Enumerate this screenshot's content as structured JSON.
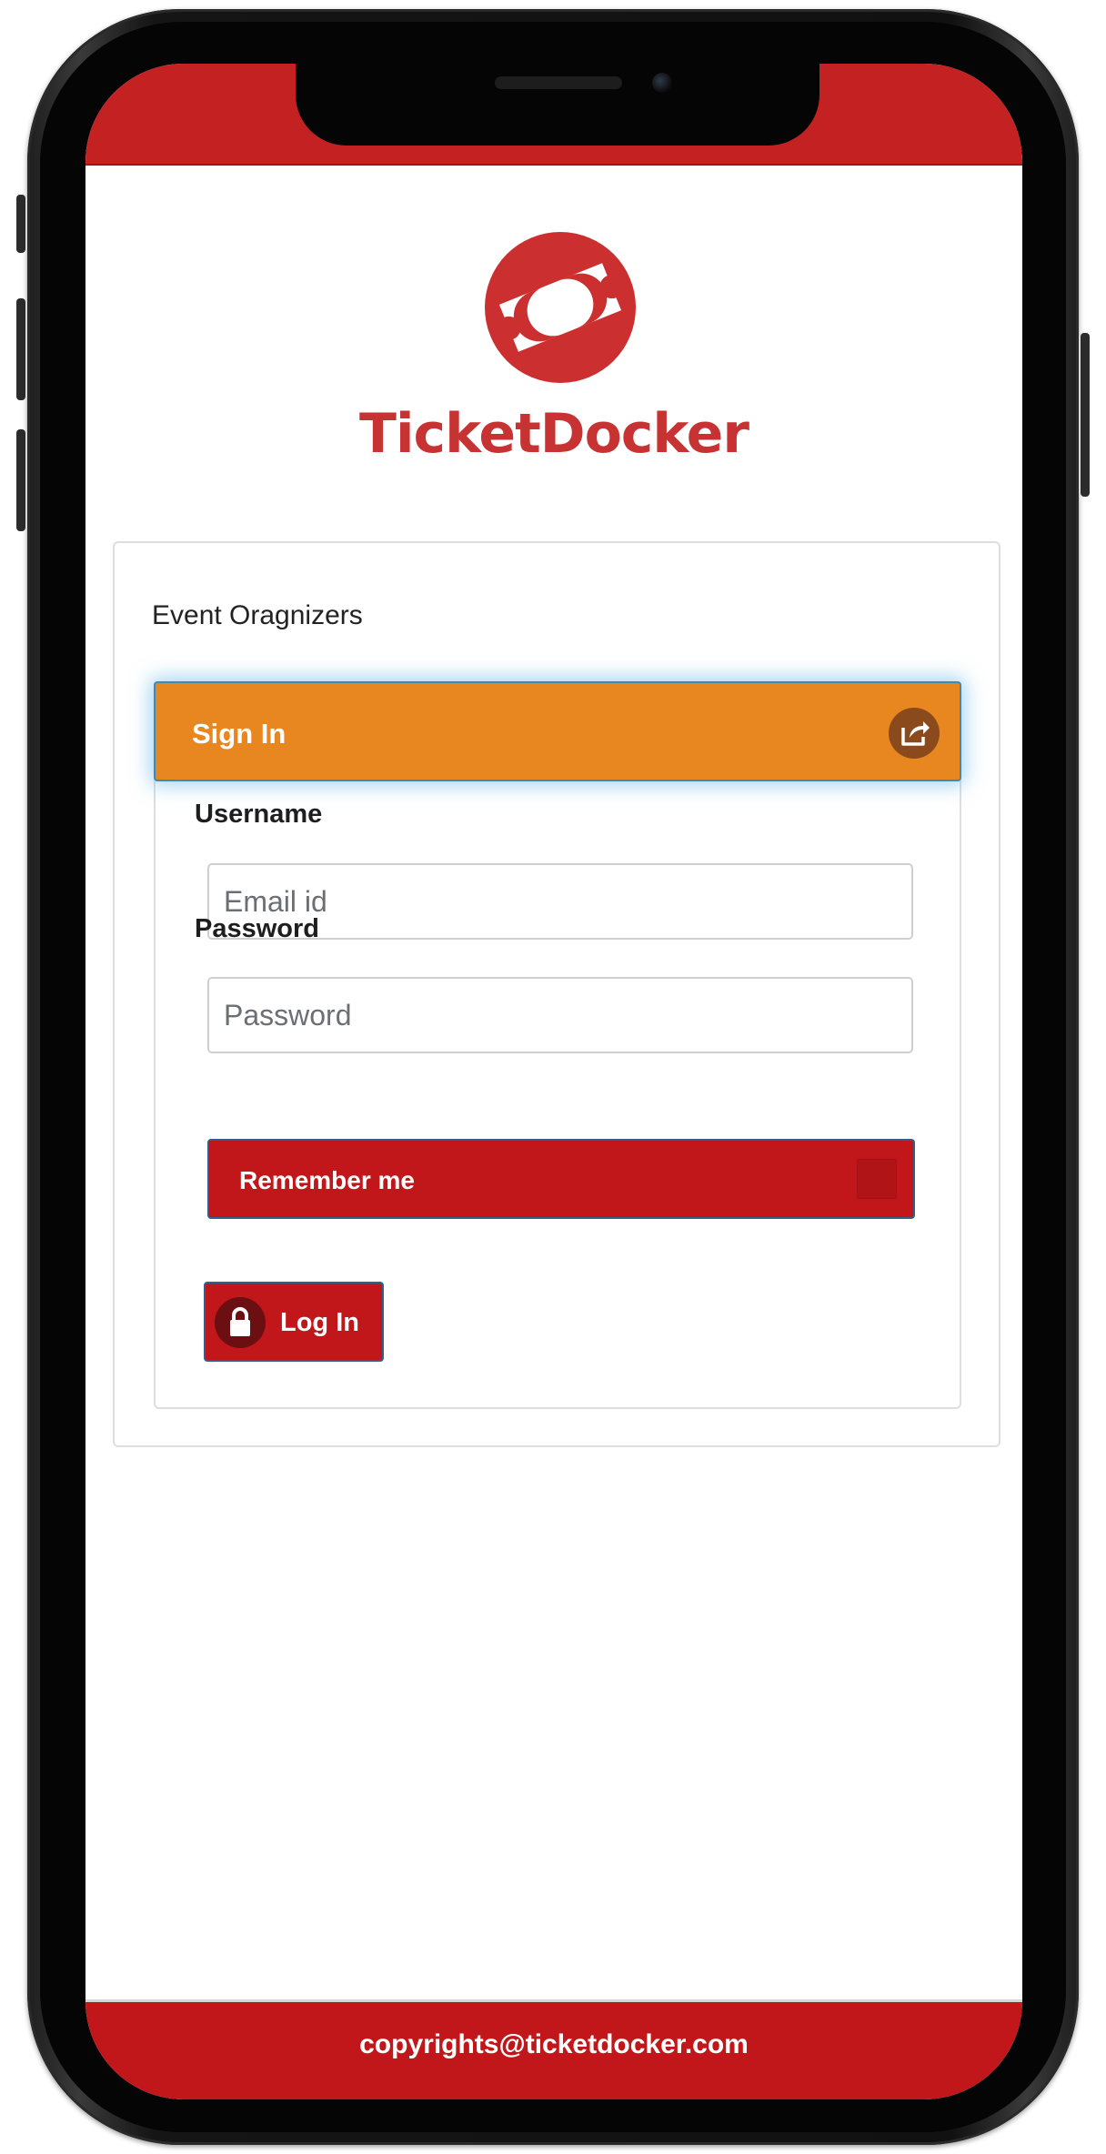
{
  "brand": {
    "name": "TicketDocker",
    "color": "#c73232"
  },
  "card": {
    "section_label": "Event Oragnizers",
    "header_title": "Sign In",
    "header_color": "#e8861f"
  },
  "form": {
    "username_label": "Username",
    "username_placeholder": "Email id",
    "password_label": "Password",
    "password_placeholder": "Password",
    "remember_label": "Remember me",
    "login_label": "Log In",
    "button_color": "#c1171a"
  },
  "footer": {
    "text": "copyrights@ticketdocker.com"
  },
  "icons": [
    "ticket-logo-icon",
    "share-icon",
    "lock-icon"
  ]
}
